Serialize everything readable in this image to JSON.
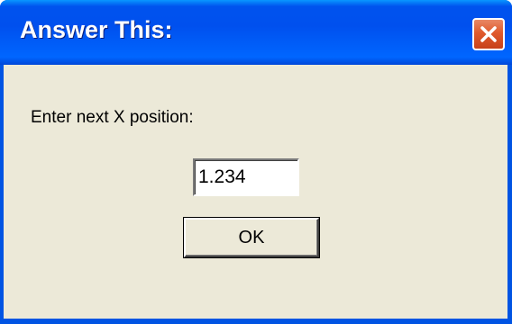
{
  "window": {
    "title": "Answer This:",
    "close_icon": "close-icon"
  },
  "dialog": {
    "prompt": "Enter next X position:",
    "input_value": "1.234",
    "ok_label": "OK"
  },
  "colors": {
    "titlebar": "#0054e3",
    "close_button": "#e05a2c",
    "dialog_background": "#ece9d8"
  }
}
